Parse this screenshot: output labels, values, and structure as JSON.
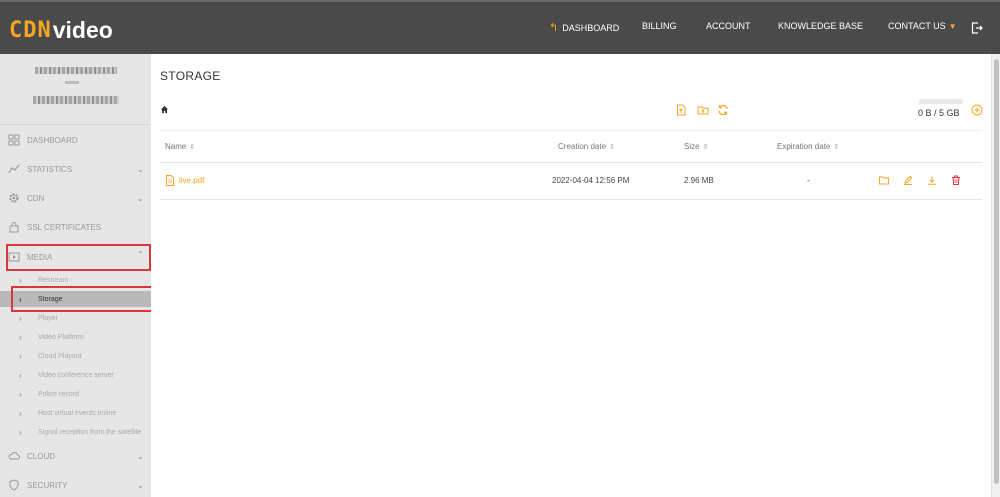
{
  "brand": {
    "logo_mark": "CDN",
    "logo_word": "video",
    "accent": "#f5a623"
  },
  "topnav": {
    "dashboard": "DASHBOARD",
    "billing": "BILLING",
    "account": "ACCOUNT",
    "knowledge_base": "KNOWLEDGE BASE",
    "contact_us": "CONTACT US"
  },
  "sidebar": {
    "items": {
      "dashboard": "DASHBOARD",
      "statistics": "STATISTICS",
      "cdn": "CDN",
      "ssl": "SSL CERTIFICATES",
      "media": "MEDIA",
      "cloud": "CLOUD",
      "security": "SECURITY"
    },
    "media_sub": [
      "Restream",
      "Storage",
      "Player",
      "Video Platform",
      "Cloud Playout",
      "Video conference server",
      "Police record",
      "Host virtual events online",
      "Signal reception from the satellite"
    ],
    "active_sub": "Storage"
  },
  "main": {
    "title": "STORAGE",
    "quota": {
      "text": "0 B / 5 GB",
      "used_fraction": 0.0
    },
    "table": {
      "headers": {
        "name": "Name",
        "created": "Creation date",
        "size": "Size",
        "expires": "Expiration date"
      },
      "rows": [
        {
          "name": "live.pdf",
          "created": "2022-04-04 12:56 PM",
          "size": "2.96 MB",
          "expires": "-"
        }
      ]
    }
  },
  "icons": {
    "home": "home-icon",
    "upload_file": "upload-file-icon",
    "upload_folder": "upload-folder-icon",
    "refresh": "refresh-icon",
    "add": "add-icon",
    "logout": "logout-icon"
  },
  "colors": {
    "topbar": "#4a4a4a",
    "sidebar": "#e6e6e6",
    "highlight": "#d9363e",
    "delete": "#d9363e"
  }
}
